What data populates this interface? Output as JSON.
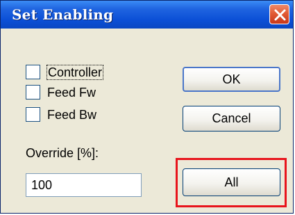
{
  "window": {
    "title": "Set Enabling"
  },
  "checkboxes": [
    {
      "label": "Controller",
      "checked": false
    },
    {
      "label": "Feed Fw",
      "checked": false
    },
    {
      "label": "Feed Bw",
      "checked": false
    }
  ],
  "buttons": {
    "ok_label": "OK",
    "cancel_label": "Cancel",
    "all_label": "All"
  },
  "override": {
    "label": "Override [%]:",
    "value": "100"
  },
  "colors": {
    "titlebar": "#0b4fd6",
    "dialog_bg": "#ece9d8",
    "highlight": "#e8141c",
    "close_button": "#e25b35"
  },
  "icons": {
    "close": "close-icon"
  }
}
